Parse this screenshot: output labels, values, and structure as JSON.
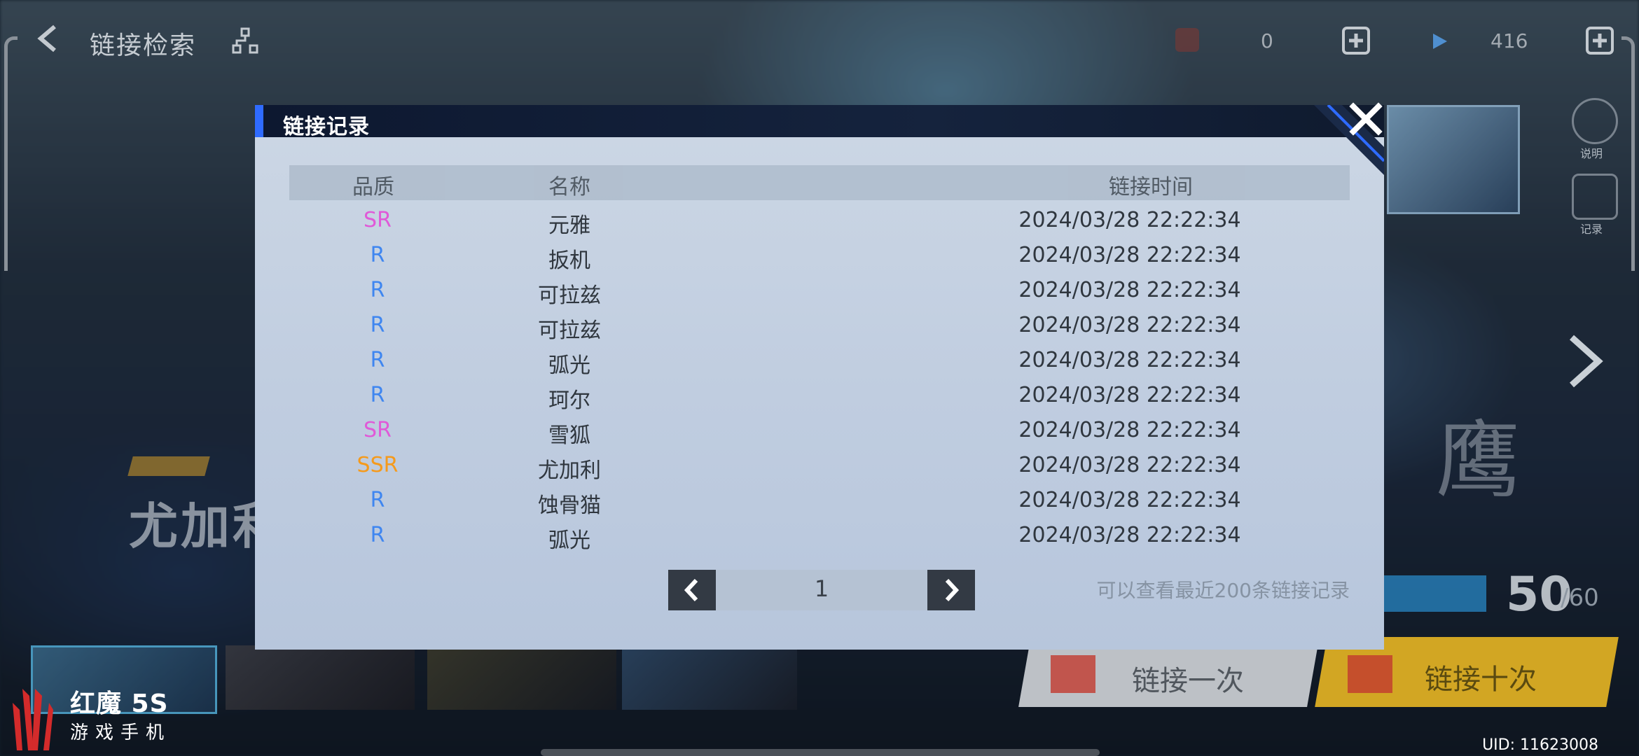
{
  "topbar": {
    "title": "链接检索",
    "resource1_value": "0",
    "resource2_value": "416"
  },
  "background": {
    "character_name": "尤加利",
    "big_char": "鹰",
    "side_btn1_label": "说明",
    "side_btn2_label": "记录",
    "count": "50",
    "count_max": "/60",
    "btn_once": "链接一次",
    "btn_ten": "链接十次"
  },
  "dialog": {
    "title": "链接记录",
    "columns": {
      "quality": "品质",
      "name": "名称",
      "time": "链接时间"
    },
    "rows": [
      {
        "quality": "SR",
        "name": "元雅",
        "time": "2024/03/28 22:22:34"
      },
      {
        "quality": "R",
        "name": "扳机",
        "time": "2024/03/28 22:22:34"
      },
      {
        "quality": "R",
        "name": "可拉兹",
        "time": "2024/03/28 22:22:34"
      },
      {
        "quality": "R",
        "name": "可拉兹",
        "time": "2024/03/28 22:22:34"
      },
      {
        "quality": "R",
        "name": "弧光",
        "time": "2024/03/28 22:22:34"
      },
      {
        "quality": "R",
        "name": "珂尔",
        "time": "2024/03/28 22:22:34"
      },
      {
        "quality": "SR",
        "name": "雪狐",
        "time": "2024/03/28 22:22:34"
      },
      {
        "quality": "SSR",
        "name": "尤加利",
        "time": "2024/03/28 22:22:34"
      },
      {
        "quality": "R",
        "name": "蚀骨猫",
        "time": "2024/03/28 22:22:34"
      },
      {
        "quality": "R",
        "name": "弧光",
        "time": "2024/03/28 22:22:34"
      }
    ],
    "page": "1",
    "hint": "可以查看最近200条链接记录"
  },
  "quality_colors": {
    "SSR": "#f59a1c",
    "SR": "#e05ad8",
    "R": "#3f86f0"
  },
  "watermark": {
    "brand": "红魔 5S",
    "sub": "游戏手机"
  },
  "uid": "UID: 11623008",
  "accent_color": "#2f6bff"
}
